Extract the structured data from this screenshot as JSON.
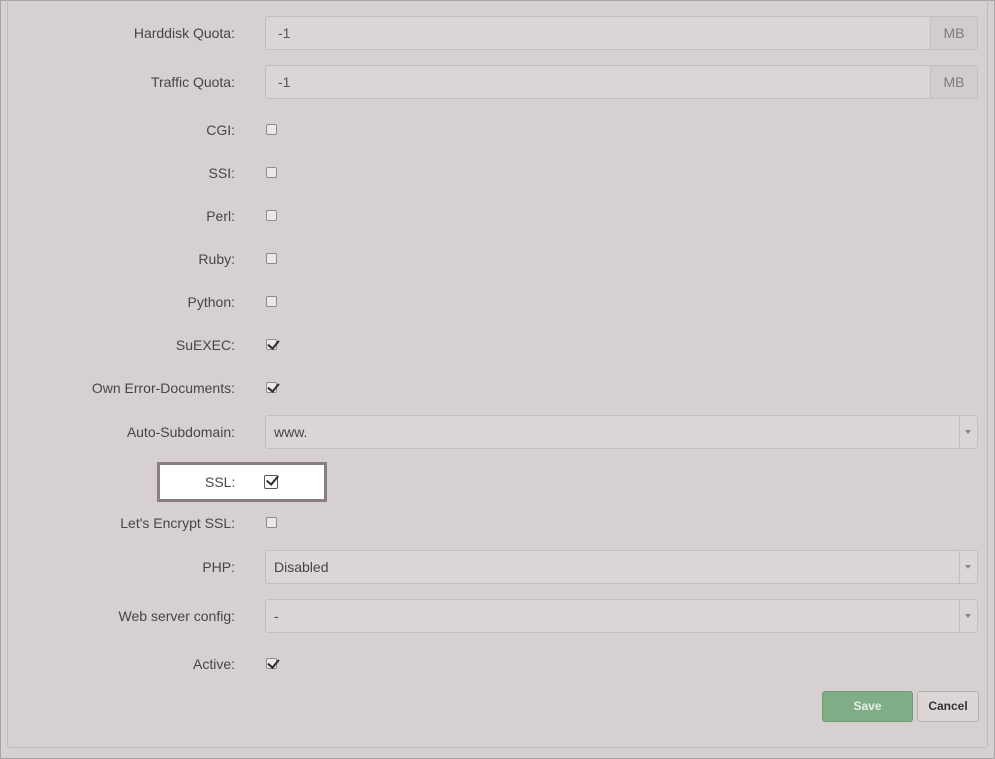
{
  "form": {
    "harddisk_quota": {
      "label": "Harddisk Quota:",
      "value": "-1",
      "unit": "MB"
    },
    "traffic_quota": {
      "label": "Traffic Quota:",
      "value": "-1",
      "unit": "MB"
    },
    "cgi": {
      "label": "CGI:",
      "checked": false
    },
    "ssi": {
      "label": "SSI:",
      "checked": false
    },
    "perl": {
      "label": "Perl:",
      "checked": false
    },
    "ruby": {
      "label": "Ruby:",
      "checked": false
    },
    "python": {
      "label": "Python:",
      "checked": false
    },
    "suexec": {
      "label": "SuEXEC:",
      "checked": true
    },
    "own_error_documents": {
      "label": "Own Error-Documents:",
      "checked": true
    },
    "auto_subdomain": {
      "label": "Auto-Subdomain:",
      "selected": "www."
    },
    "ssl": {
      "label": "SSL:",
      "checked": true
    },
    "lets_encrypt_ssl": {
      "label": "Let's Encrypt SSL:",
      "checked": false
    },
    "php": {
      "label": "PHP:",
      "selected": "Disabled"
    },
    "web_server_config": {
      "label": "Web server config:",
      "selected": "-"
    },
    "active": {
      "label": "Active:",
      "checked": true
    }
  },
  "buttons": {
    "save": "Save",
    "cancel": "Cancel"
  },
  "colors": {
    "save_button": "#7fad85",
    "highlight_border": "#8a7e80"
  }
}
